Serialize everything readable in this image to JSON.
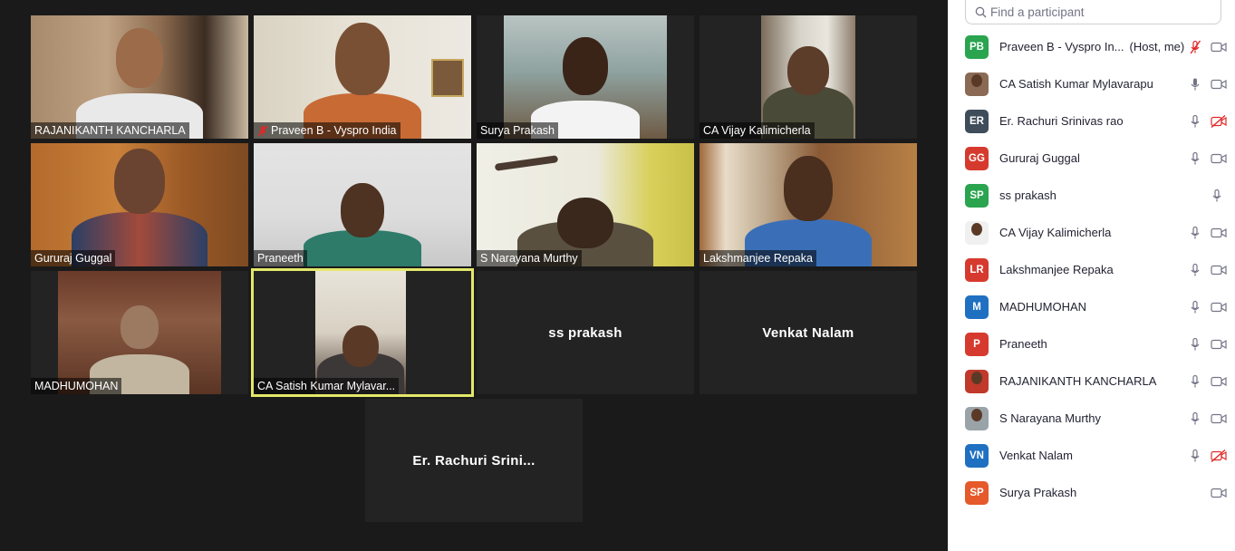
{
  "gallery": {
    "tiles": [
      {
        "name": "RAJANIKANTH KANCHARLA",
        "muted": false
      },
      {
        "name": "Praveen B - Vyspro India",
        "muted": true
      },
      {
        "name": "Surya Prakash",
        "muted": false
      },
      {
        "name": "CA Vijay Kalimicherla",
        "muted": false
      },
      {
        "name": "Gururaj Guggal",
        "muted": false
      },
      {
        "name": "Praneeth",
        "muted": false
      },
      {
        "name": "S Narayana Murthy",
        "muted": false
      },
      {
        "name": "Lakshmanjee Repaka",
        "muted": false
      },
      {
        "name": "MADHUMOHAN",
        "muted": false
      },
      {
        "name": "CA Satish Kumar Mylavar...",
        "muted": false,
        "active": true
      },
      {
        "name": "ss prakash",
        "video": false
      },
      {
        "name": "Venkat Nalam",
        "video": false
      },
      {
        "name": "Er. Rachuri Srini...",
        "video": false
      }
    ]
  },
  "panel": {
    "search_placeholder": "Find a participant",
    "participants": [
      {
        "initials": "PB",
        "name": "Praveen B - Vyspro In...",
        "role": "(Host, me)",
        "color": "#2aa44f",
        "mic": "muted-red",
        "cam": "on"
      },
      {
        "initials": "",
        "name": "CA Satish Kumar Mylavarapu",
        "color": "#8a6a55",
        "photo": true,
        "mic": "active",
        "cam": "on"
      },
      {
        "initials": "ER",
        "name": "Er. Rachuri Srinivas rao",
        "color": "#3f4d5a",
        "mic": "on",
        "cam": "off-red"
      },
      {
        "initials": "GG",
        "name": "Gururaj Guggal",
        "color": "#d63a2e",
        "mic": "on",
        "cam": "on"
      },
      {
        "initials": "SP",
        "name": "ss prakash",
        "color": "#2aa44f",
        "mic": "on",
        "cam": "none"
      },
      {
        "initials": "",
        "name": "CA Vijay Kalimicherla",
        "color": "#ffffff",
        "photo": true,
        "mic": "on",
        "cam": "on"
      },
      {
        "initials": "LR",
        "name": "Lakshmanjee Repaka",
        "color": "#d63a2e",
        "mic": "on",
        "cam": "on"
      },
      {
        "initials": "M",
        "name": "MADHUMOHAN",
        "color": "#1f70c1",
        "mic": "on",
        "cam": "on"
      },
      {
        "initials": "P",
        "name": "Praneeth",
        "color": "#d63a2e",
        "mic": "on",
        "cam": "on"
      },
      {
        "initials": "",
        "name": "RAJANIKANTH KANCHARLA",
        "color": "#c0392b",
        "photo": true,
        "mic": "on",
        "cam": "on"
      },
      {
        "initials": "",
        "name": "S Narayana Murthy",
        "color": "#9aa3a8",
        "photo": true,
        "mic": "on",
        "cam": "on"
      },
      {
        "initials": "VN",
        "name": "Venkat Nalam",
        "color": "#1f70c1",
        "mic": "on",
        "cam": "off-red"
      },
      {
        "initials": "SP",
        "name": "Surya Prakash",
        "color": "#e5592b",
        "mic": "none",
        "cam": "on"
      }
    ]
  }
}
